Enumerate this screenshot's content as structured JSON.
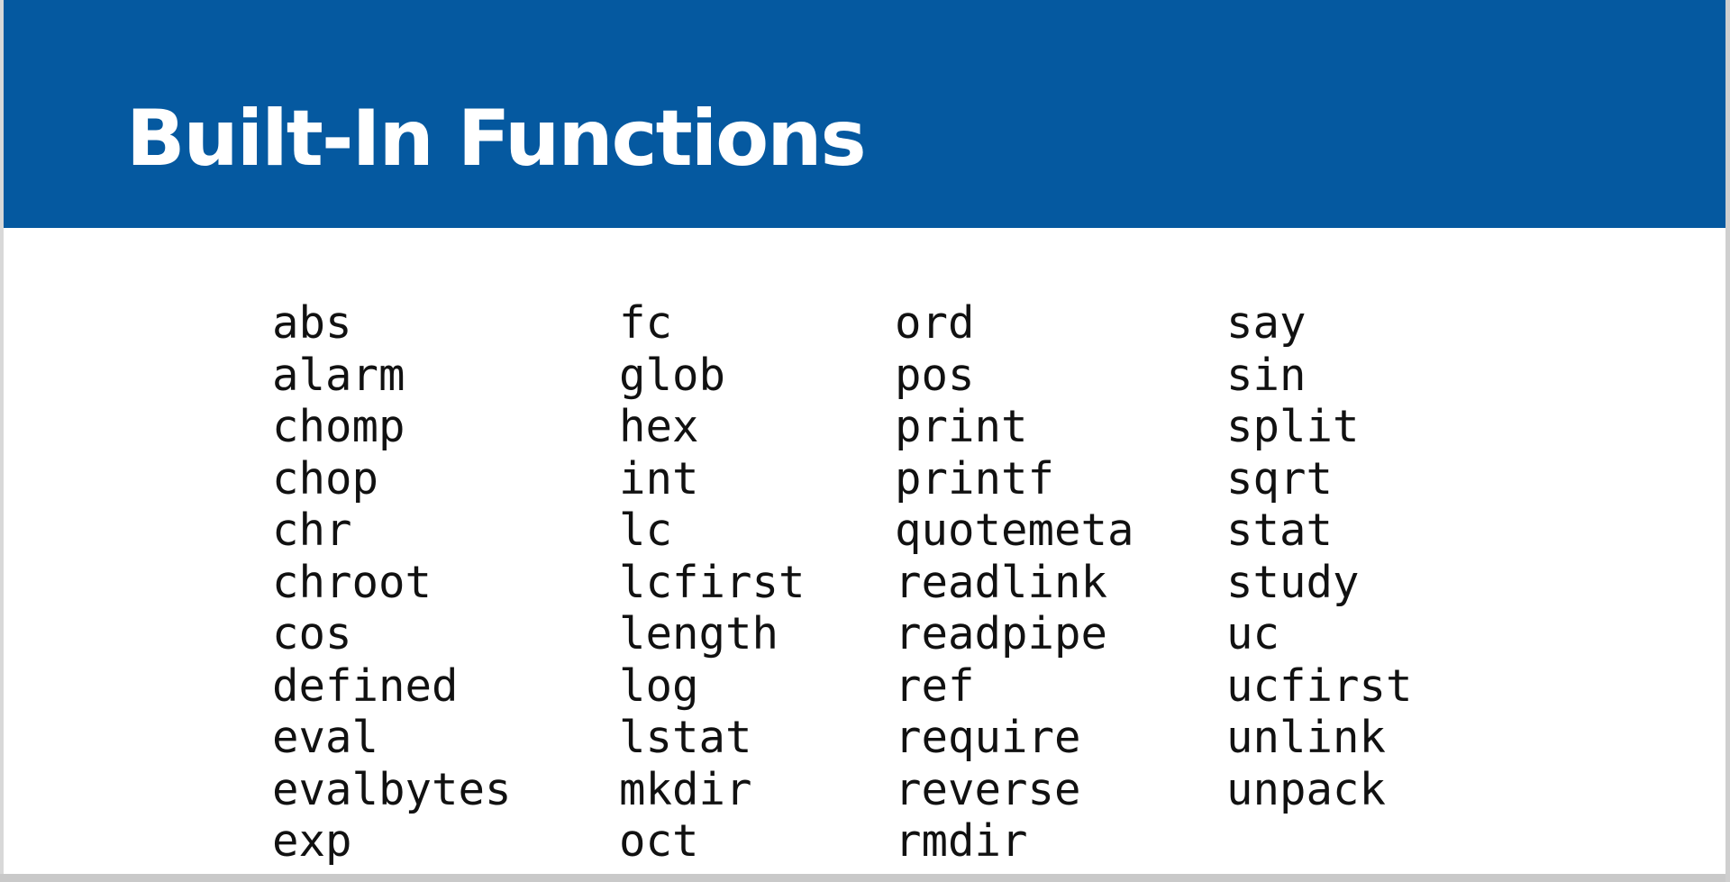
{
  "slide": {
    "title": "Built-In Functions",
    "header_color": "#0559a0",
    "columns": [
      [
        "abs",
        "alarm",
        "chomp",
        "chop",
        "chr",
        "chroot",
        "cos",
        "defined",
        "eval",
        "evalbytes",
        "exp"
      ],
      [
        "fc",
        "glob",
        "hex",
        "int",
        "lc",
        "lcfirst",
        "length",
        "log",
        "lstat",
        "mkdir",
        "oct"
      ],
      [
        "ord",
        "pos",
        "print",
        "printf",
        "quotemeta",
        "readlink",
        "readpipe",
        "ref",
        "require",
        "reverse",
        "rmdir"
      ],
      [
        "say",
        "sin",
        "split",
        "sqrt",
        "stat",
        "study",
        "uc",
        "ucfirst",
        "unlink",
        "unpack"
      ]
    ]
  }
}
